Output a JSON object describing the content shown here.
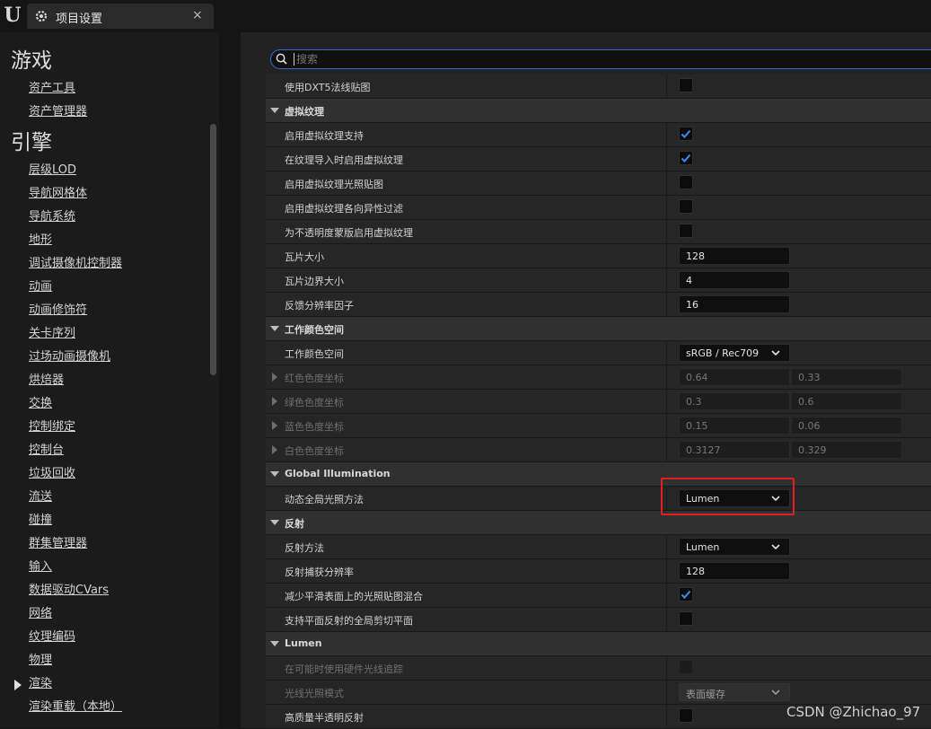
{
  "app": {
    "logo": "U",
    "tab_title": "项目设置",
    "tab_close": "×"
  },
  "search": {
    "placeholder": "搜索",
    "value": ""
  },
  "sidebar": {
    "categories": [
      {
        "title": "游戏",
        "items": [
          "资产工具",
          "资产管理器"
        ]
      },
      {
        "title": "引擎",
        "items": [
          "层级LOD",
          "导航网格体",
          "导航系统",
          "地形",
          "调试摄像机控制器",
          "动画",
          "动画修饰符",
          "关卡序列",
          "过场动画摄像机",
          "烘焙器",
          "交换",
          "控制绑定",
          "控制台",
          "垃圾回收",
          "流送",
          "碰撞",
          "群集管理器",
          "输入",
          "数据驱动CVars",
          "网络",
          "纹理编码",
          "物理",
          "渲染",
          "渲染重载（本地）"
        ]
      }
    ],
    "selected_item": "渲染"
  },
  "rows": [
    {
      "type": "prop",
      "label": "使用DXT5法线贴图",
      "control": "checkbox",
      "checked": false
    },
    {
      "type": "section",
      "label": "虚拟纹理"
    },
    {
      "type": "prop",
      "label": "启用虚拟纹理支持",
      "control": "checkbox",
      "checked": true
    },
    {
      "type": "prop",
      "label": "在纹理导入时启用虚拟纹理",
      "control": "checkbox",
      "checked": true
    },
    {
      "type": "prop",
      "label": "启用虚拟纹理光照贴图",
      "control": "checkbox",
      "checked": false
    },
    {
      "type": "prop",
      "label": "启用虚拟纹理各向异性过滤",
      "control": "checkbox",
      "checked": false
    },
    {
      "type": "prop",
      "label": "为不透明度蒙版启用虚拟纹理",
      "control": "checkbox",
      "checked": false
    },
    {
      "type": "prop",
      "label": "瓦片大小",
      "control": "number",
      "value": "128"
    },
    {
      "type": "prop",
      "label": "瓦片边界大小",
      "control": "number",
      "value": "4"
    },
    {
      "type": "prop",
      "label": "反馈分辨率因子",
      "control": "number",
      "value": "16"
    },
    {
      "type": "section",
      "label": "工作颜色空间"
    },
    {
      "type": "prop",
      "label": "工作颜色空间",
      "control": "dropdown",
      "value": "sRGB / Rec709"
    },
    {
      "type": "collapsed",
      "label": "红色色度坐标",
      "values": [
        "0.64",
        "0.33"
      ]
    },
    {
      "type": "collapsed",
      "label": "绿色色度坐标",
      "values": [
        "0.3",
        "0.6"
      ]
    },
    {
      "type": "collapsed",
      "label": "蓝色色度坐标",
      "values": [
        "0.15",
        "0.06"
      ]
    },
    {
      "type": "collapsed",
      "label": "白色色度坐标",
      "values": [
        "0.3127",
        "0.329"
      ]
    },
    {
      "type": "section",
      "label": "Global Illumination"
    },
    {
      "type": "prop",
      "label": "动态全局光照方法",
      "control": "dropdown",
      "value": "Lumen",
      "highlighted": true
    },
    {
      "type": "section",
      "label": "反射"
    },
    {
      "type": "prop",
      "label": "反射方法",
      "control": "dropdown",
      "value": "Lumen"
    },
    {
      "type": "prop",
      "label": "反射捕获分辨率",
      "control": "number",
      "value": "128"
    },
    {
      "type": "prop",
      "label": "减少平滑表面上的光照贴图混合",
      "control": "checkbox",
      "checked": true
    },
    {
      "type": "prop",
      "label": "支持平面反射的全局剪切平面",
      "control": "checkbox",
      "checked": false
    },
    {
      "type": "section",
      "label": "Lumen"
    },
    {
      "type": "prop",
      "label": "在可能时使用硬件光线追踪",
      "control": "checkbox",
      "checked": false,
      "disabled": true
    },
    {
      "type": "prop",
      "label": "光线光照模式",
      "control": "dropdown",
      "value": "表面缓存",
      "disabled": true
    },
    {
      "type": "prop",
      "label": "高质量半透明反射",
      "control": "checkbox",
      "checked": false
    }
  ],
  "watermark": "CSDN @Zhichao_97",
  "colors": {
    "accent": "#2e6fd3",
    "highlight": "#e02020",
    "check": "#3d8bf0"
  }
}
